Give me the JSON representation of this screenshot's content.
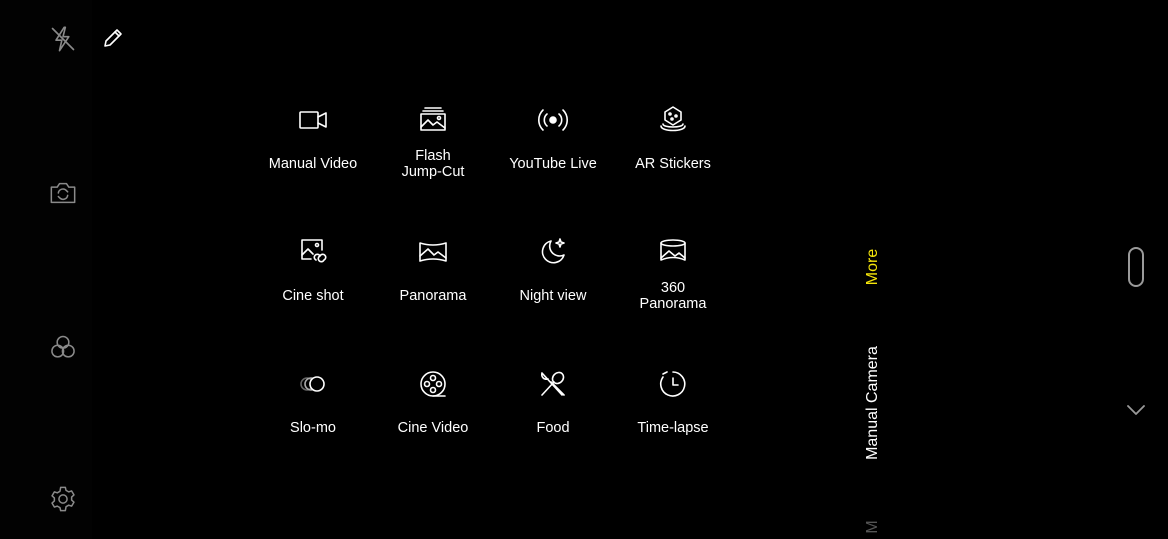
{
  "left_toolbar": {
    "icons": [
      "flash-off-icon",
      "pencil-icon",
      "switch-camera-icon",
      "filters-icon",
      "settings-icon"
    ]
  },
  "modes": [
    {
      "label": "Manual Video",
      "icon": "video-camera-icon"
    },
    {
      "label": "Flash\nJump-Cut",
      "icon": "stacked-photos-icon"
    },
    {
      "label": "YouTube Live",
      "icon": "live-broadcast-icon"
    },
    {
      "label": "AR Stickers",
      "icon": "ar-sticker-icon"
    },
    {
      "label": "Cine shot",
      "icon": "cine-shot-icon"
    },
    {
      "label": "Panorama",
      "icon": "panorama-icon"
    },
    {
      "label": "Night view",
      "icon": "moon-icon"
    },
    {
      "label": "360\nPanorama",
      "icon": "panorama-360-icon"
    },
    {
      "label": "Slo-mo",
      "icon": "slo-mo-icon"
    },
    {
      "label": "Cine Video",
      "icon": "film-reel-icon"
    },
    {
      "label": "Food",
      "icon": "fork-spoon-icon"
    },
    {
      "label": "Time-lapse",
      "icon": "timer-icon"
    }
  ],
  "mode_strip": {
    "active": "More",
    "next": "Manual Camera",
    "partial": "M",
    "active_color": "#f5e50a"
  },
  "right": {
    "icons": [
      "shutter-handle-icon",
      "chevron-down-icon"
    ]
  }
}
